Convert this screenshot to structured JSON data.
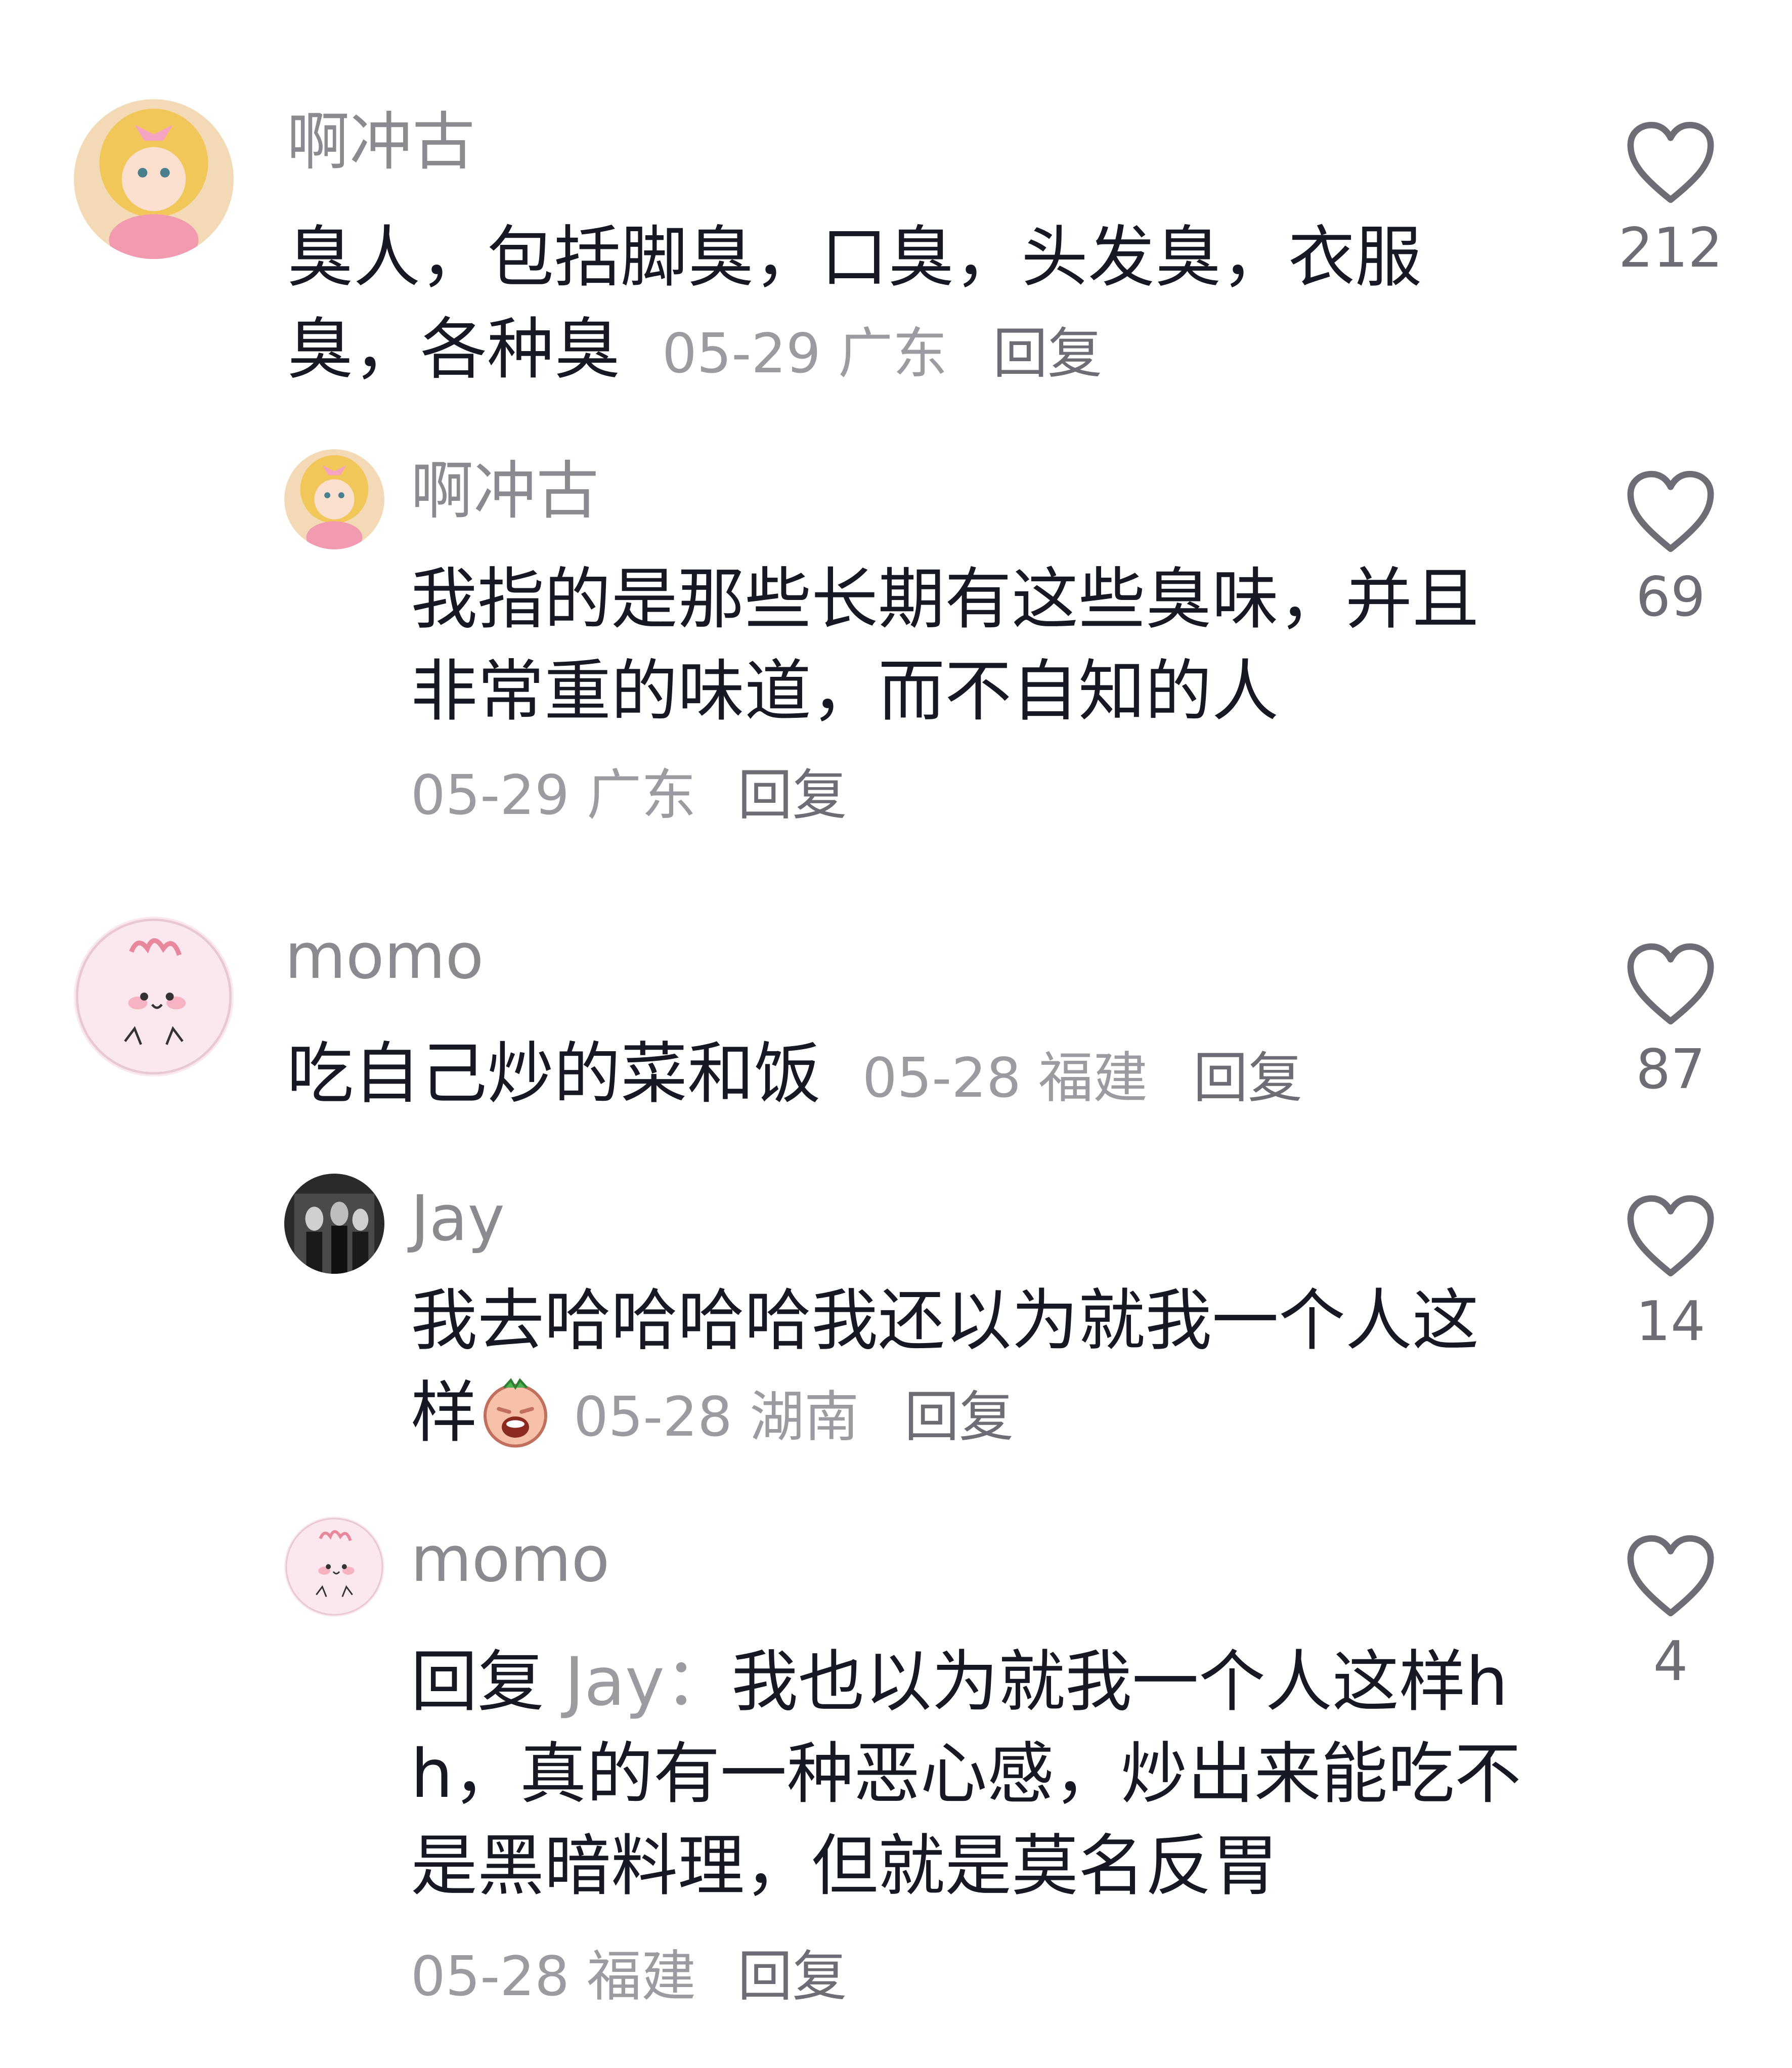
{
  "comments": [
    {
      "username": "啊冲古",
      "text": "臭人，包括脚臭，口臭，头发臭，衣服臭，各种臭",
      "date_location": "05-29 广东",
      "reply_label": "回复",
      "likes": "212"
    },
    {
      "username": "啊冲古",
      "text": "我指的是那些长期有这些臭味，并且非常重的味道，而不自知的人",
      "date_location": "05-29 广东",
      "reply_label": "回复",
      "likes": "69"
    },
    {
      "username": "momo",
      "text": "吃自己炒的菜和饭",
      "date_location": "05-28 福建",
      "reply_label": "回复",
      "likes": "87"
    },
    {
      "username": "Jay",
      "text": "我去哈哈哈哈我还以为就我一个人这样",
      "emoji": "crying-face-emoji",
      "date_location": "05-28 湖南",
      "reply_label": "回复",
      "likes": "14"
    },
    {
      "username": "momo",
      "reply_prefix": "回复",
      "reply_target": "Jay：",
      "text": "我也以为就我一个人这样hh，真的有一种恶心感，炒出来能吃不是黑暗料理，但就是莫名反胃",
      "date_location": "05-28 福建",
      "reply_label": "回复",
      "likes": "4"
    }
  ],
  "colors": {
    "text": "#161823",
    "username": "#8a8b91",
    "meta": "#9b9ca1",
    "heart": "#6d6e75"
  },
  "icons": {
    "like": "heart-outline-icon"
  }
}
